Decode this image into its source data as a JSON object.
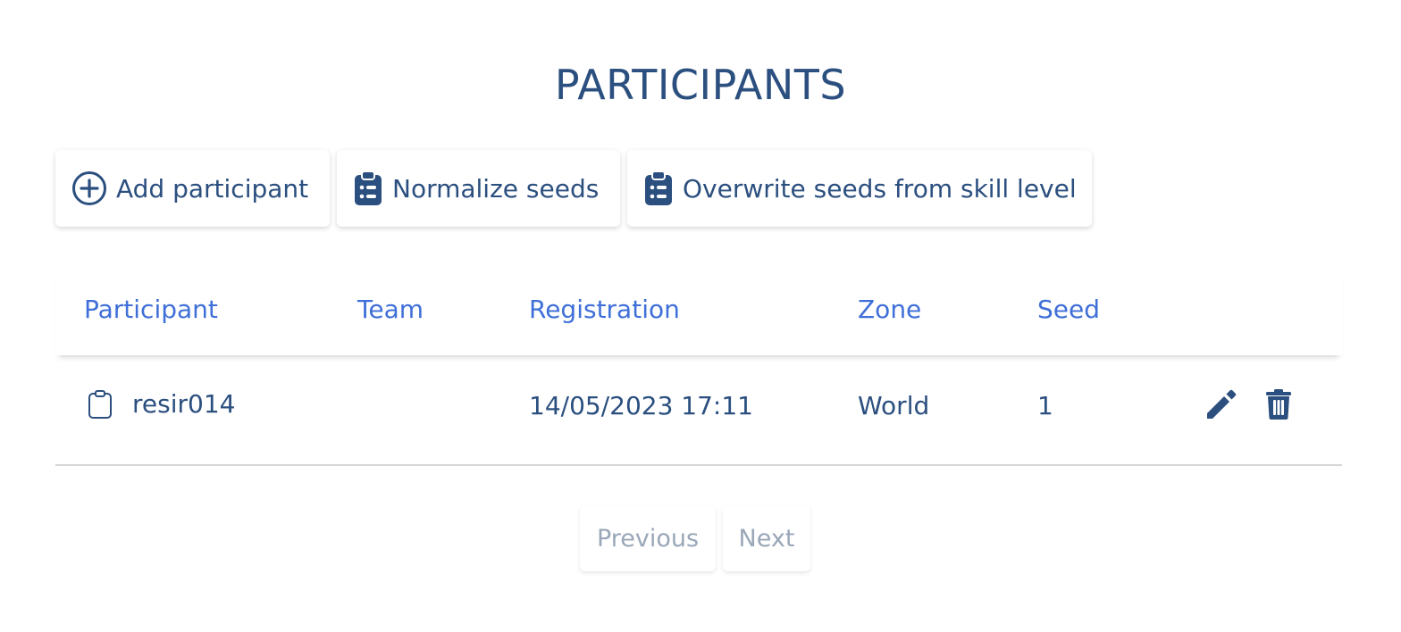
{
  "page": {
    "title": "PARTICIPANTS"
  },
  "toolbar": {
    "add_label": "Add participant",
    "normalize_label": "Normalize seeds",
    "overwrite_label": "Overwrite seeds from skill level"
  },
  "table": {
    "columns": [
      "Participant",
      "Team",
      "Registration",
      "Zone",
      "Seed"
    ],
    "rows": [
      {
        "participant": "resir014",
        "team": "",
        "registration": "14/05/2023 17:11",
        "zone": "World",
        "seed": "1"
      }
    ]
  },
  "pagination": {
    "previous_label": "Previous",
    "next_label": "Next"
  },
  "icons": {
    "add": "plus-circle-icon",
    "normalize": "clipboard-list-icon",
    "overwrite": "clipboard-list-icon",
    "participant": "clipboard-icon",
    "edit": "pencil-icon",
    "delete": "trash-icon"
  },
  "colors": {
    "primary": "#2b4f7f",
    "header_text": "#3f6fd8",
    "disabled_text": "#9aa7b8"
  }
}
